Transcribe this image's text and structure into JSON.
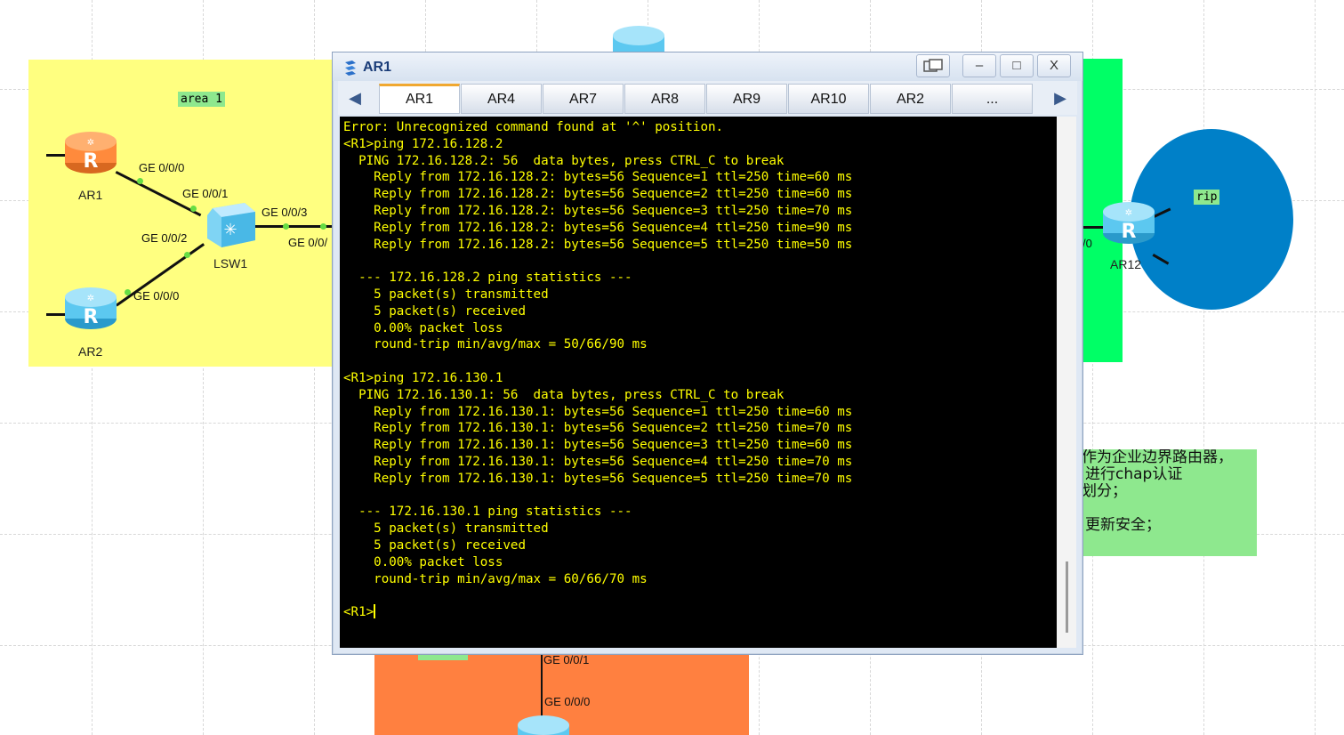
{
  "topology": {
    "area_label": "area 1",
    "rip_label": "rip",
    "devices": {
      "ar1": "AR1",
      "ar2": "AR2",
      "lsw1": "LSW1",
      "ar12": "AR12"
    },
    "ports": {
      "ar1_ge000": "GE 0/0/0",
      "lsw_ge001": "GE 0/0/1",
      "lsw_ge002": "GE 0/0/2",
      "lsw_ge003": "GE 0/0/3",
      "ar2_ge000": "GE 0/0/0",
      "lsw_ge00x": "GE 0/0/",
      "ar12_port": "/0",
      "bottom_ge001": "GE 0/0/1",
      "bottom_ge000": "GE 0/0/0"
    },
    "note_lines": [
      "作为企业边界路由器，",
      "进行chap认证",
      "划分；",
      "",
      "更新安全；"
    ],
    "colors": {
      "area_yellow": "#ffff80",
      "area_green": "#00ff66",
      "area_orange": "#ff8040",
      "rip_circle": "#0080c8",
      "router_orange": "#ff8a3c",
      "router_blue": "#5cc8f0"
    }
  },
  "window": {
    "title": "AR1",
    "icon": "terminal-app-icon",
    "buttons": {
      "restore": "restore-icon",
      "minimize": "–",
      "maximize": "□",
      "close": "X"
    },
    "tabs": [
      "AR1",
      "AR4",
      "AR7",
      "AR8",
      "AR9",
      "AR10",
      "AR2",
      "..."
    ],
    "active_tab": "AR1"
  },
  "terminal": {
    "lines": [
      "Error: Unrecognized command found at '^' position.",
      "<R1>ping 172.16.128.2",
      "  PING 172.16.128.2: 56  data bytes, press CTRL_C to break",
      "    Reply from 172.16.128.2: bytes=56 Sequence=1 ttl=250 time=60 ms",
      "    Reply from 172.16.128.2: bytes=56 Sequence=2 ttl=250 time=60 ms",
      "    Reply from 172.16.128.2: bytes=56 Sequence=3 ttl=250 time=70 ms",
      "    Reply from 172.16.128.2: bytes=56 Sequence=4 ttl=250 time=90 ms",
      "    Reply from 172.16.128.2: bytes=56 Sequence=5 ttl=250 time=50 ms",
      "",
      "  --- 172.16.128.2 ping statistics ---",
      "    5 packet(s) transmitted",
      "    5 packet(s) received",
      "    0.00% packet loss",
      "    round-trip min/avg/max = 50/66/90 ms",
      "",
      "<R1>ping 172.16.130.1",
      "  PING 172.16.130.1: 56  data bytes, press CTRL_C to break",
      "    Reply from 172.16.130.1: bytes=56 Sequence=1 ttl=250 time=60 ms",
      "    Reply from 172.16.130.1: bytes=56 Sequence=2 ttl=250 time=70 ms",
      "    Reply from 172.16.130.1: bytes=56 Sequence=3 ttl=250 time=60 ms",
      "    Reply from 172.16.130.1: bytes=56 Sequence=4 ttl=250 time=70 ms",
      "    Reply from 172.16.130.1: bytes=56 Sequence=5 ttl=250 time=70 ms",
      "",
      "  --- 172.16.130.1 ping statistics ---",
      "    5 packet(s) transmitted",
      "    5 packet(s) received",
      "    0.00% packet loss",
      "    round-trip min/avg/max = 60/66/70 ms",
      "",
      "<R1>"
    ]
  }
}
